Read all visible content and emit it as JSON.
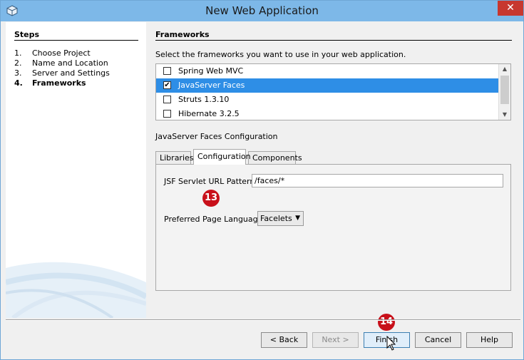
{
  "window": {
    "title": "New Web Application",
    "close_glyph": "✕"
  },
  "steps": {
    "heading": "Steps",
    "items": [
      {
        "num": "1.",
        "label": "Choose Project"
      },
      {
        "num": "2.",
        "label": "Name and Location"
      },
      {
        "num": "3.",
        "label": "Server and Settings"
      },
      {
        "num": "4.",
        "label": "Frameworks"
      }
    ]
  },
  "frameworks": {
    "heading": "Frameworks",
    "instruction": "Select the frameworks you want to use in your web application.",
    "items": [
      {
        "label": "Spring Web MVC",
        "checked": false
      },
      {
        "label": "JavaServer Faces",
        "checked": true,
        "check_glyph": "✔"
      },
      {
        "label": "Struts 1.3.10",
        "checked": false
      },
      {
        "label": "Hibernate 3.2.5",
        "checked": false
      }
    ]
  },
  "config": {
    "label": "JavaServer Faces Configuration",
    "tabs": [
      "Libraries",
      "Configuration",
      "Components"
    ],
    "active_tab": "Configuration",
    "url_pattern_label": "JSF Servlet URL Pattern:",
    "url_pattern_value": "/faces/*",
    "page_language_label": "Preferred Page Language:",
    "page_language_value": "Facelets"
  },
  "annotations": {
    "badge_13": "13",
    "badge_14": "14"
  },
  "buttons": {
    "back": "< Back",
    "next": "Next >",
    "finish": "Finish",
    "cancel": "Cancel",
    "help": "Help"
  },
  "colors": {
    "title_bar": "#7db8e8",
    "selection": "#2e8ee6",
    "badge": "#c8101a",
    "close": "#c7372f"
  }
}
